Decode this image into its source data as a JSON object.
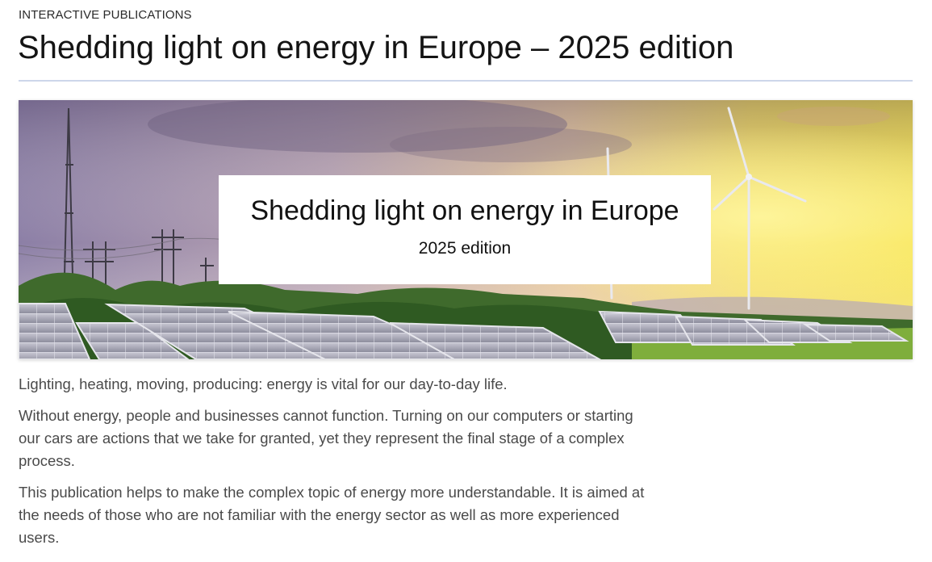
{
  "header": {
    "eyebrow": "INTERACTIVE PUBLICATIONS",
    "title": "Shedding light on energy in Europe – 2025 edition"
  },
  "banner": {
    "title": "Shedding light on energy in Europe",
    "subtitle": "2025 edition"
  },
  "intro": {
    "paragraphs": [
      "Lighting, heating, moving, producing: energy is vital for our day-to-day life.",
      "Without energy, people and businesses cannot function. Turning on our computers or starting our cars are actions that we take for granted, yet they represent the final stage of a complex process.",
      "This publication helps to make the complex topic of energy more understandable. It is aimed at the needs of those who are not familiar with the energy sector as well as more experienced users."
    ]
  },
  "colors": {
    "rule": "#cdd6ea",
    "sky_left": "#8c7fa6",
    "sky_right": "#f6e24a",
    "body_text": "#4a4a4a"
  }
}
